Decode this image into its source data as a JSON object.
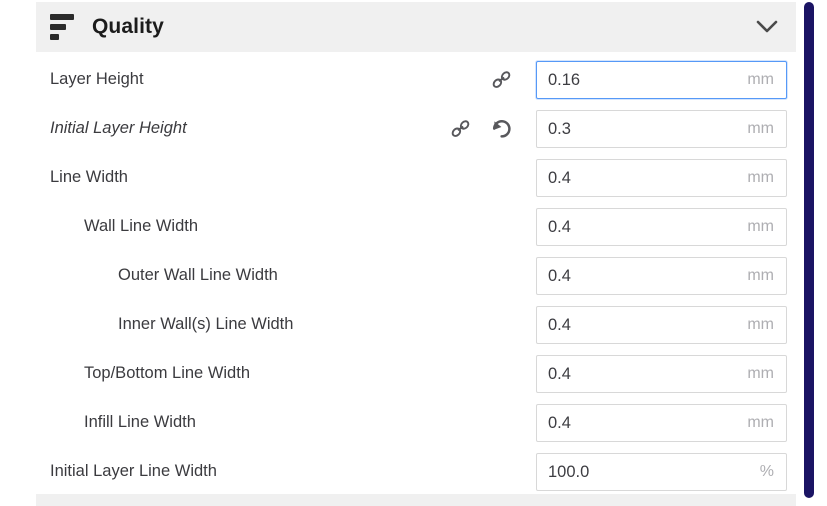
{
  "category": {
    "title": "Quality",
    "icon": "quality-bars-icon",
    "collapse_icon": "chevron-down-icon",
    "expanded": true,
    "header_bg": "#f0f0f0"
  },
  "settings": [
    {
      "label": "Layer Height",
      "indent": 0,
      "italic": false,
      "value": "0.16",
      "unit": "mm",
      "focused": true,
      "link_icon": true,
      "link_icon_position": "right",
      "revert_icon": false
    },
    {
      "label": "Initial Layer Height",
      "indent": 0,
      "italic": true,
      "value": "0.3",
      "unit": "mm",
      "focused": false,
      "link_icon": true,
      "link_icon_position": "left",
      "revert_icon": true
    },
    {
      "label": "Line Width",
      "indent": 0,
      "italic": false,
      "value": "0.4",
      "unit": "mm",
      "focused": false,
      "link_icon": false,
      "revert_icon": false
    },
    {
      "label": "Wall Line Width",
      "indent": 1,
      "italic": false,
      "value": "0.4",
      "unit": "mm",
      "focused": false,
      "link_icon": false,
      "revert_icon": false
    },
    {
      "label": "Outer Wall Line Width",
      "indent": 2,
      "italic": false,
      "value": "0.4",
      "unit": "mm",
      "focused": false,
      "link_icon": false,
      "revert_icon": false
    },
    {
      "label": "Inner Wall(s) Line Width",
      "indent": 2,
      "italic": false,
      "value": "0.4",
      "unit": "mm",
      "focused": false,
      "link_icon": false,
      "revert_icon": false
    },
    {
      "label": "Top/Bottom Line Width",
      "indent": 1,
      "italic": false,
      "value": "0.4",
      "unit": "mm",
      "focused": false,
      "link_icon": false,
      "revert_icon": false
    },
    {
      "label": "Infill Line Width",
      "indent": 1,
      "italic": false,
      "value": "0.4",
      "unit": "mm",
      "focused": false,
      "link_icon": false,
      "revert_icon": false
    },
    {
      "label": "Initial Layer Line Width",
      "indent": 0,
      "italic": false,
      "value": "100.0",
      "unit": "%",
      "focused": false,
      "link_icon": false,
      "revert_icon": false
    }
  ],
  "scrollbar": {
    "name": "vertical-scrollbar",
    "color": "#1b1464",
    "thumb_position": "top"
  },
  "colors": {
    "focus_border": "#5699f7",
    "field_border": "#d8d8d8",
    "label_text": "#3b3b3f",
    "unit_text": "#aeaeb2"
  }
}
